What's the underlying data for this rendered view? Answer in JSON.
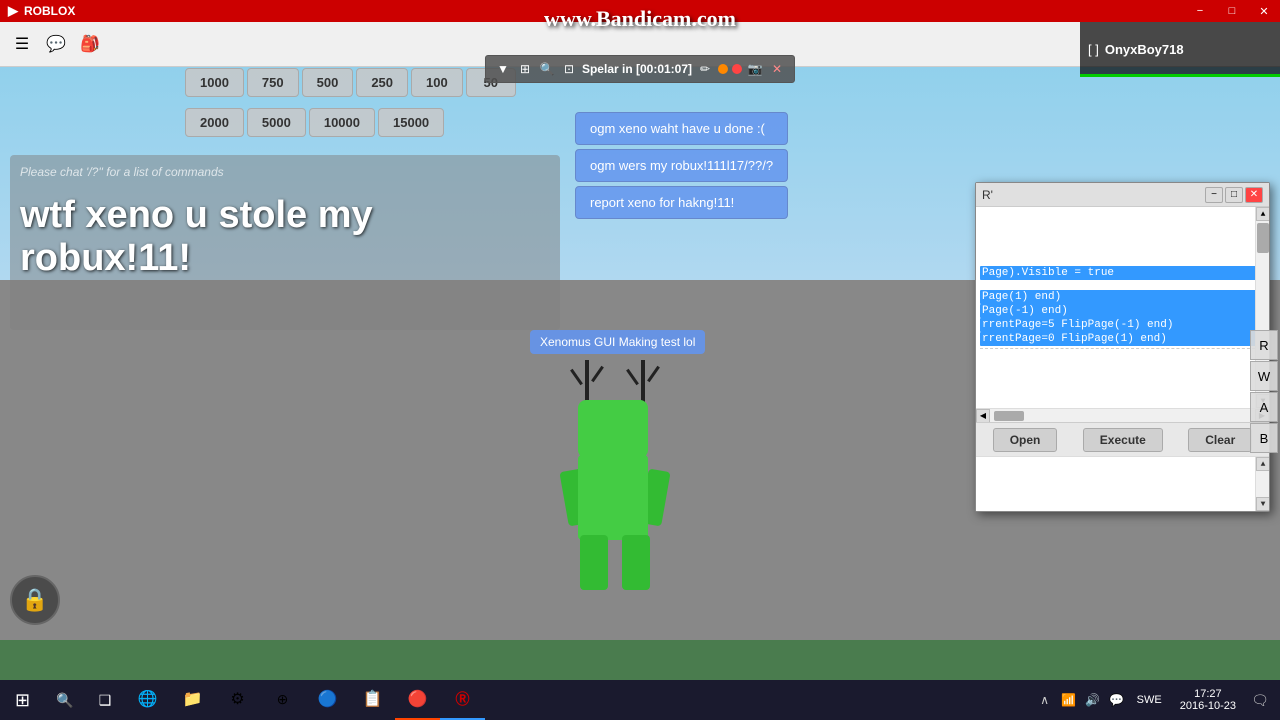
{
  "titlebar": {
    "title": "ROBLOX",
    "minimize": "−",
    "maximize": "□",
    "close": "✕"
  },
  "bandicam": {
    "watermark": "www.Bandicam.com"
  },
  "recording": {
    "timer": "Spelar in [00:01:07]"
  },
  "player": {
    "name": "OnyxBoy718",
    "display": "[ ]OnyxBoy718"
  },
  "topButtons": {
    "btn1": "1000",
    "btn2": "750",
    "btn3": "500",
    "btn4": "250",
    "btn5": "100",
    "btn6": "50",
    "btn7": "2000",
    "btn8": "5000",
    "btn9": "10000",
    "btn10": "15000"
  },
  "chatMessages": {
    "msg1": "ogm xeno waht have u done :(",
    "msg2": "ogm wers my robux!111l17/??/?",
    "msg3": "report xeno for hakng!11!"
  },
  "chatPanel": {
    "hint": "Please chat '/?'' for a list of commands",
    "mainText": "wtf xeno u stole my robux!11!"
  },
  "character": {
    "tooltip": "Xenomus GUI Making test lol"
  },
  "scriptEditor": {
    "title": "R'",
    "codeLine1": "Page).Visible = true",
    "codeLine2": "Page(1) end)",
    "codeLine3": "Page(-1) end)",
    "codeLine4": "rrentPage=5 FlipPage(-1) end)",
    "codeLine5": "rrentPage=0 FlipPage(1) end)",
    "buttons": {
      "open": "Open",
      "execute": "Execute",
      "clear": "Clear"
    }
  },
  "taskbar": {
    "time": "17:27",
    "date": "2016-10-23",
    "language": "SWE",
    "apps": [
      "⊞",
      "🔍",
      "❑",
      "📁",
      "⚙",
      "🌐",
      "📂",
      "🛡",
      "⬛",
      "🔴",
      "Ⓡ"
    ]
  }
}
